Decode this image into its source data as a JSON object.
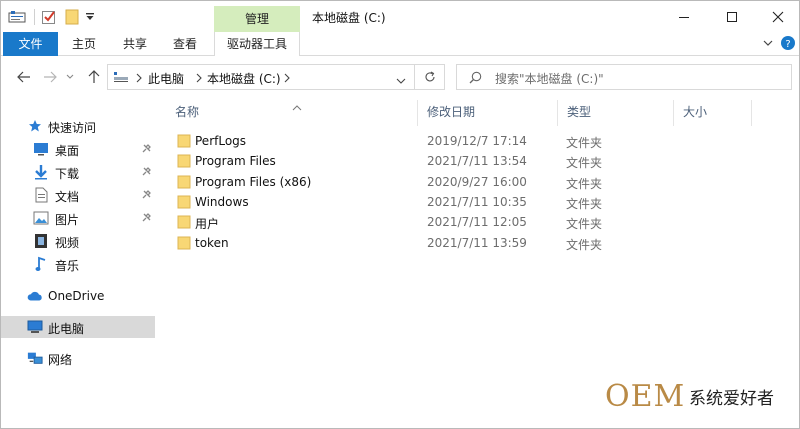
{
  "window": {
    "title": "本地磁盘 (C:)",
    "context_tab": "管理",
    "controls": [
      "minimize",
      "maximize",
      "close"
    ]
  },
  "quick_access_toolbar": {
    "icons": [
      "properties-icon",
      "check-icon",
      "new-folder-icon",
      "customize-dropdown-icon"
    ]
  },
  "ribbon": {
    "tabs": [
      "文件",
      "主页",
      "共享",
      "查看"
    ],
    "context_tab_label": "驱动器工具"
  },
  "navigation": {
    "path": [
      "此电脑",
      "本地磁盘 (C:)"
    ],
    "search_placeholder": "搜索\"本地磁盘 (C:)\""
  },
  "sidebar": {
    "quick_access": "快速访问",
    "pinned": [
      {
        "label": "桌面",
        "icon": "desktop-icon",
        "pinned": true
      },
      {
        "label": "下载",
        "icon": "download-icon",
        "pinned": true
      },
      {
        "label": "文档",
        "icon": "document-icon",
        "pinned": true
      },
      {
        "label": "图片",
        "icon": "pictures-icon",
        "pinned": true
      },
      {
        "label": "视频",
        "icon": "video-icon",
        "pinned": false
      },
      {
        "label": "音乐",
        "icon": "music-icon",
        "pinned": false
      }
    ],
    "onedrive": "OneDrive",
    "this_pc": "此电脑",
    "network": "网络"
  },
  "columns": [
    "名称",
    "修改日期",
    "类型",
    "大小"
  ],
  "files": [
    {
      "name": "PerfLogs",
      "modified": "2019/12/7 17:14",
      "type": "文件夹",
      "size": ""
    },
    {
      "name": "Program Files",
      "modified": "2021/7/11 13:54",
      "type": "文件夹",
      "size": ""
    },
    {
      "name": "Program Files (x86)",
      "modified": "2020/9/27 16:00",
      "type": "文件夹",
      "size": ""
    },
    {
      "name": "Windows",
      "modified": "2021/7/11 10:35",
      "type": "文件夹",
      "size": ""
    },
    {
      "name": "用户",
      "modified": "2021/7/11 12:05",
      "type": "文件夹",
      "size": ""
    },
    {
      "name": "token",
      "modified": "2021/7/11 13:59",
      "type": "文件夹",
      "size": ""
    }
  ],
  "watermark": {
    "brand": "OEM",
    "text": "系统爱好者"
  },
  "colors": {
    "accent": "#1979ca",
    "context_tab": "#d5edbd",
    "selection": "#d9d9d9",
    "folder": "#f8d775",
    "column_header": "#4c607a"
  }
}
